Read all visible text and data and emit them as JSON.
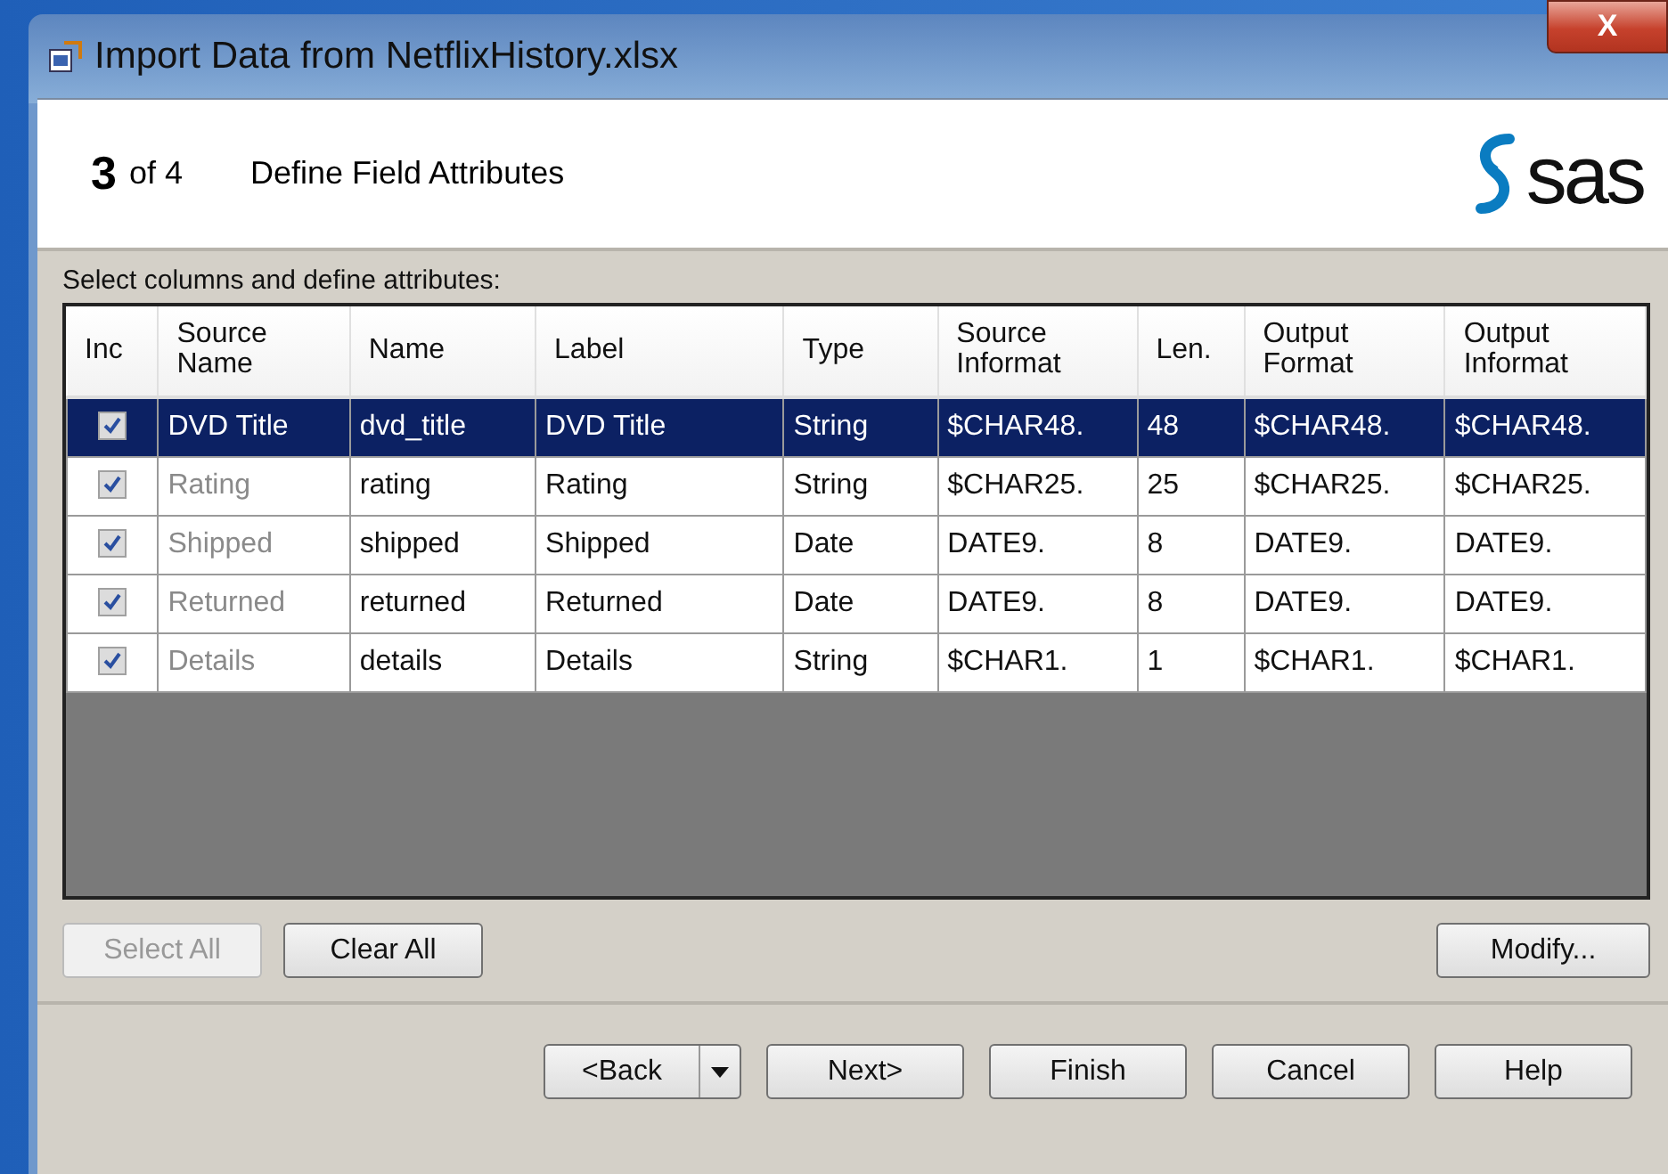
{
  "window": {
    "title": "Import Data from NetflixHistory.xlsx",
    "close": "X"
  },
  "header": {
    "step": "3",
    "of": "of 4",
    "title": "Define Field Attributes",
    "logo": "sas"
  },
  "table": {
    "caption": "Select columns and define attributes:",
    "include_column": "Inc",
    "columns": [
      "Source\nName",
      "Name",
      "Label",
      "Type",
      "Source\nInformat",
      "Len.",
      "Output\nFormat",
      "Output\nInformat"
    ],
    "rows": [
      {
        "checked": true,
        "selected": true,
        "cells": [
          "DVD Title",
          "dvd_title",
          "DVD Title",
          "String",
          "$CHAR48.",
          "48",
          "$CHAR48.",
          "$CHAR48."
        ]
      },
      {
        "checked": true,
        "selected": false,
        "cells": [
          "Rating",
          "rating",
          "Rating",
          "String",
          "$CHAR25.",
          "25",
          "$CHAR25.",
          "$CHAR25."
        ]
      },
      {
        "checked": true,
        "selected": false,
        "cells": [
          "Shipped",
          "shipped",
          "Shipped",
          "Date",
          "DATE9.",
          "8",
          "DATE9.",
          "DATE9."
        ]
      },
      {
        "checked": true,
        "selected": false,
        "cells": [
          "Returned",
          "returned",
          "Returned",
          "Date",
          "DATE9.",
          "8",
          "DATE9.",
          "DATE9."
        ]
      },
      {
        "checked": true,
        "selected": false,
        "cells": [
          "Details",
          "details",
          "Details",
          "String",
          "$CHAR1.",
          "1",
          "$CHAR1.",
          "$CHAR1."
        ]
      }
    ]
  },
  "table_buttons": [
    {
      "label": "Select All",
      "disabled": true
    },
    {
      "label": "Clear All",
      "disabled": false
    },
    {
      "label": "Modify...",
      "disabled": false
    }
  ],
  "nav_buttons": [
    "<Back",
    "Next>",
    "Finish",
    "Cancel",
    "Help"
  ]
}
